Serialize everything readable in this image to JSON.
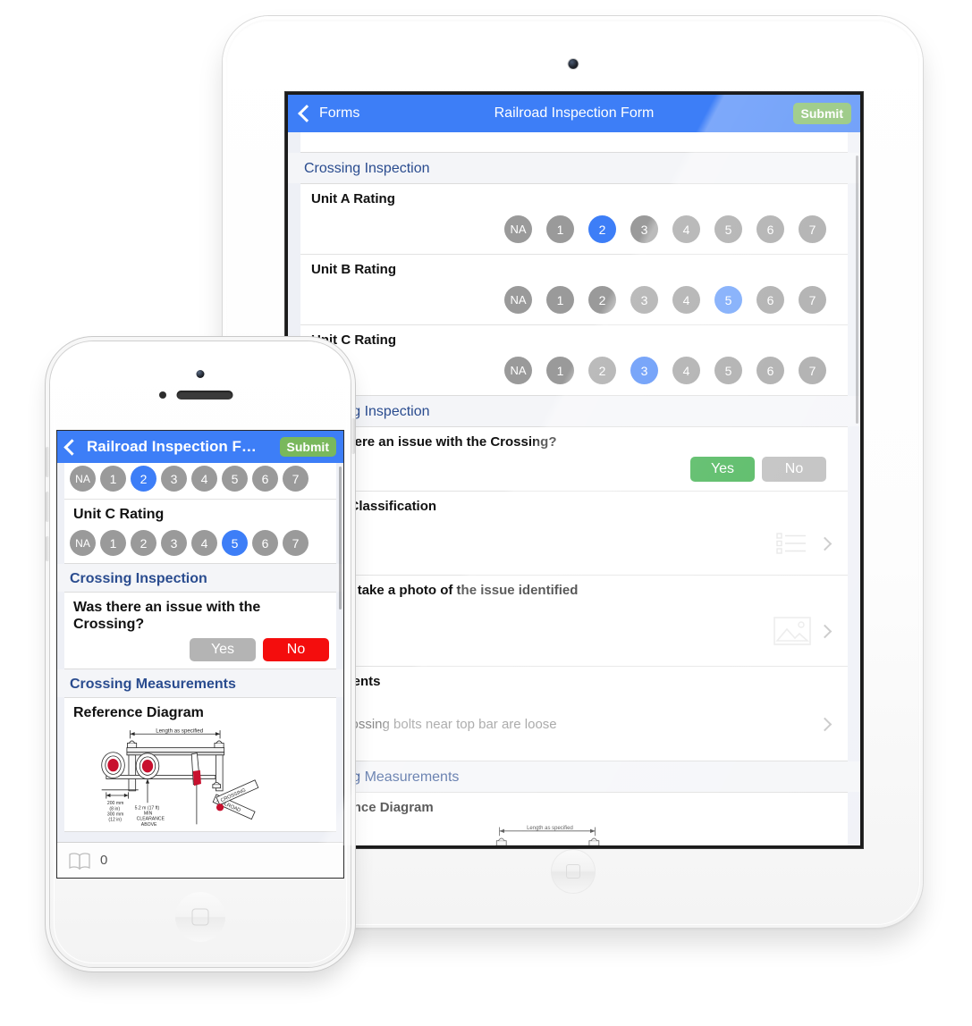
{
  "app": {
    "nav": {
      "back_label": "Forms",
      "title_tablet": "Railroad Inspection Form",
      "title_phone": "Railroad Inspection F…",
      "submit_label": "Submit"
    },
    "colors": {
      "nav_blue": "#3d7ef7",
      "submit_green": "#79b85c",
      "section_header_blue": "#2a4c8f",
      "dot_gray": "#9a9a9a",
      "dot_selected_blue": "#3d7ef7",
      "yes_green": "#2eaa3f",
      "no_red": "#f40d0d",
      "inactive_gray": "#b4b4b4",
      "screen_bg": "#eef0f6"
    }
  },
  "tablet": {
    "sections": [
      {
        "title": "Crossing Inspection",
        "ratings": [
          {
            "label": "Unit A Rating",
            "options": [
              "NA",
              "1",
              "2",
              "3",
              "4",
              "5",
              "6",
              "7"
            ],
            "selected": "2"
          },
          {
            "label": "Unit B Rating",
            "options": [
              "NA",
              "1",
              "2",
              "3",
              "4",
              "5",
              "6",
              "7"
            ],
            "selected": "5"
          },
          {
            "label": "Unit C Rating",
            "options": [
              "NA",
              "1",
              "2",
              "3",
              "4",
              "5",
              "6",
              "7"
            ],
            "selected": "3"
          }
        ]
      },
      {
        "title": "Crossing Inspection",
        "questions": [
          {
            "label": "Was there an issue with the Crossing?",
            "type": "yesno",
            "yes_label": "Yes",
            "no_label": "No",
            "selected": "Yes"
          },
          {
            "label": "Issue Classification",
            "type": "list"
          },
          {
            "label": "Please take a photo of the issue identified",
            "type": "photo"
          },
          {
            "label": "Comments",
            "type": "text",
            "value": "The crossing bolts near top bar are loose"
          }
        ]
      },
      {
        "title": "Crossing Measurements",
        "diagram": {
          "label": "Reference Diagram"
        }
      }
    ]
  },
  "phone": {
    "partial_rating": {
      "options": [
        "NA",
        "1",
        "2",
        "3",
        "4",
        "5",
        "6",
        "7"
      ],
      "selected": "2"
    },
    "rating": {
      "label": "Unit C Rating",
      "options": [
        "NA",
        "1",
        "2",
        "3",
        "4",
        "5",
        "6",
        "7"
      ],
      "selected": "5"
    },
    "sections": [
      {
        "title": "Crossing Inspection",
        "question": {
          "label": "Was there an issue with the Crossing?",
          "yes_label": "Yes",
          "no_label": "No",
          "selected": "No"
        }
      },
      {
        "title": "Crossing Measurements",
        "diagram": {
          "label": "Reference Diagram"
        }
      }
    ],
    "toolbar": {
      "count": "0"
    }
  },
  "diagram": {
    "length_label": "Length as specified",
    "left_dim": [
      "200 mm",
      "(8 in)",
      "300 mm",
      "(12 in)"
    ],
    "clearance": [
      "5.2 m (17 ft)",
      "MIN",
      "CLEARANCE",
      "ABOVE"
    ],
    "sign_text": [
      "RAILROAD",
      "CROSSING"
    ]
  }
}
